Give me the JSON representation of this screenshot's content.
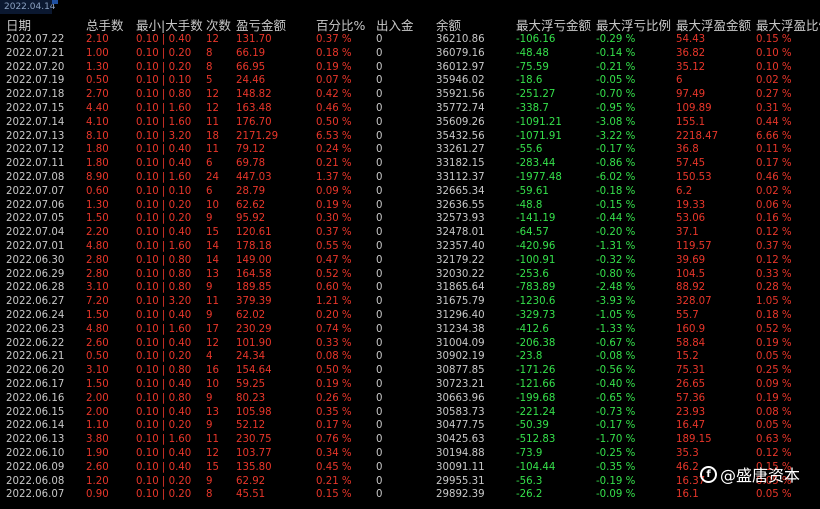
{
  "top_tab": "2022.04.14",
  "headers": [
    "日期",
    "总手数",
    "最小|大手数",
    "次数",
    "盈亏金额",
    "百分比%",
    "出入金",
    "余额",
    "最大浮亏金额",
    "最大浮亏比例",
    "最大浮盈金额",
    "最大浮盈比例"
  ],
  "rows": [
    [
      "2022.07.22",
      "2.10",
      "0.10 | 0.40",
      "12",
      "131.70",
      "0.37 %",
      "0",
      "36210.86",
      "-106.16",
      "-0.29 %",
      "54.43",
      "0.15 %"
    ],
    [
      "2022.07.21",
      "1.00",
      "0.10 | 0.20",
      "8",
      "66.19",
      "0.18 %",
      "0",
      "36079.16",
      "-48.48",
      "-0.14 %",
      "36.82",
      "0.10 %"
    ],
    [
      "2022.07.20",
      "1.30",
      "0.10 | 0.20",
      "8",
      "66.95",
      "0.19 %",
      "0",
      "36012.97",
      "-75.59",
      "-0.21 %",
      "35.12",
      "0.10 %"
    ],
    [
      "2022.07.19",
      "0.50",
      "0.10 | 0.10",
      "5",
      "24.46",
      "0.07 %",
      "0",
      "35946.02",
      "-18.6",
      "-0.05 %",
      "6",
      "0.02 %"
    ],
    [
      "2022.07.18",
      "2.70",
      "0.10 | 0.80",
      "12",
      "148.82",
      "0.42 %",
      "0",
      "35921.56",
      "-251.27",
      "-0.70 %",
      "97.49",
      "0.27 %"
    ],
    [
      "2022.07.15",
      "4.40",
      "0.10 | 1.60",
      "12",
      "163.48",
      "0.46 %",
      "0",
      "35772.74",
      "-338.7",
      "-0.95 %",
      "109.89",
      "0.31 %"
    ],
    [
      "2022.07.14",
      "4.10",
      "0.10 | 1.60",
      "11",
      "176.70",
      "0.50 %",
      "0",
      "35609.26",
      "-1091.21",
      "-3.08 %",
      "155.1",
      "0.44 %"
    ],
    [
      "2022.07.13",
      "8.10",
      "0.10 | 3.20",
      "18",
      "2171.29",
      "6.53 %",
      "0",
      "35432.56",
      "-1071.91",
      "-3.22 %",
      "2218.47",
      "6.66 %"
    ],
    [
      "2022.07.12",
      "1.80",
      "0.10 | 0.40",
      "11",
      "79.12",
      "0.24 %",
      "0",
      "33261.27",
      "-55.6",
      "-0.17 %",
      "36.8",
      "0.11 %"
    ],
    [
      "2022.07.11",
      "1.80",
      "0.10 | 0.40",
      "6",
      "69.78",
      "0.21 %",
      "0",
      "33182.15",
      "-283.44",
      "-0.86 %",
      "57.45",
      "0.17 %"
    ],
    [
      "2022.07.08",
      "8.90",
      "0.10 | 1.60",
      "24",
      "447.03",
      "1.37 %",
      "0",
      "33112.37",
      "-1977.48",
      "-6.02 %",
      "150.53",
      "0.46 %"
    ],
    [
      "2022.07.07",
      "0.60",
      "0.10 | 0.10",
      "6",
      "28.79",
      "0.09 %",
      "0",
      "32665.34",
      "-59.61",
      "-0.18 %",
      "6.2",
      "0.02 %"
    ],
    [
      "2022.07.06",
      "1.30",
      "0.10 | 0.20",
      "10",
      "62.62",
      "0.19 %",
      "0",
      "32636.55",
      "-48.8",
      "-0.15 %",
      "19.33",
      "0.06 %"
    ],
    [
      "2022.07.05",
      "1.50",
      "0.10 | 0.20",
      "9",
      "95.92",
      "0.30 %",
      "0",
      "32573.93",
      "-141.19",
      "-0.44 %",
      "53.06",
      "0.16 %"
    ],
    [
      "2022.07.04",
      "2.20",
      "0.10 | 0.40",
      "15",
      "120.61",
      "0.37 %",
      "0",
      "32478.01",
      "-64.57",
      "-0.20 %",
      "37.1",
      "0.12 %"
    ],
    [
      "2022.07.01",
      "4.80",
      "0.10 | 1.60",
      "14",
      "178.18",
      "0.55 %",
      "0",
      "32357.40",
      "-420.96",
      "-1.31 %",
      "119.57",
      "0.37 %"
    ],
    [
      "2022.06.30",
      "2.80",
      "0.10 | 0.80",
      "14",
      "149.00",
      "0.47 %",
      "0",
      "32179.22",
      "-100.91",
      "-0.32 %",
      "39.69",
      "0.12 %"
    ],
    [
      "2022.06.29",
      "2.80",
      "0.10 | 0.80",
      "13",
      "164.58",
      "0.52 %",
      "0",
      "32030.22",
      "-253.6",
      "-0.80 %",
      "104.5",
      "0.33 %"
    ],
    [
      "2022.06.28",
      "3.10",
      "0.10 | 0.80",
      "9",
      "189.85",
      "0.60 %",
      "0",
      "31865.64",
      "-783.89",
      "-2.48 %",
      "88.92",
      "0.28 %"
    ],
    [
      "2022.06.27",
      "7.20",
      "0.10 | 3.20",
      "11",
      "379.39",
      "1.21 %",
      "0",
      "31675.79",
      "-1230.6",
      "-3.93 %",
      "328.07",
      "1.05 %"
    ],
    [
      "2022.06.24",
      "1.50",
      "0.10 | 0.40",
      "9",
      "62.02",
      "0.20 %",
      "0",
      "31296.40",
      "-329.73",
      "-1.05 %",
      "55.7",
      "0.18 %"
    ],
    [
      "2022.06.23",
      "4.80",
      "0.10 | 1.60",
      "17",
      "230.29",
      "0.74 %",
      "0",
      "31234.38",
      "-412.6",
      "-1.33 %",
      "160.9",
      "0.52 %"
    ],
    [
      "2022.06.22",
      "2.60",
      "0.10 | 0.40",
      "12",
      "101.90",
      "0.33 %",
      "0",
      "31004.09",
      "-206.38",
      "-0.67 %",
      "58.84",
      "0.19 %"
    ],
    [
      "2022.06.21",
      "0.50",
      "0.10 | 0.20",
      "4",
      "24.34",
      "0.08 %",
      "0",
      "30902.19",
      "-23.8",
      "-0.08 %",
      "15.2",
      "0.05 %"
    ],
    [
      "2022.06.20",
      "3.10",
      "0.10 | 0.80",
      "16",
      "154.64",
      "0.50 %",
      "0",
      "30877.85",
      "-171.26",
      "-0.56 %",
      "75.31",
      "0.25 %"
    ],
    [
      "2022.06.17",
      "1.50",
      "0.10 | 0.40",
      "10",
      "59.25",
      "0.19 %",
      "0",
      "30723.21",
      "-121.66",
      "-0.40 %",
      "26.65",
      "0.09 %"
    ],
    [
      "2022.06.16",
      "2.00",
      "0.10 | 0.80",
      "9",
      "80.23",
      "0.26 %",
      "0",
      "30663.96",
      "-199.68",
      "-0.65 %",
      "57.36",
      "0.19 %"
    ],
    [
      "2022.06.15",
      "2.00",
      "0.10 | 0.40",
      "13",
      "105.98",
      "0.35 %",
      "0",
      "30583.73",
      "-221.24",
      "-0.73 %",
      "23.93",
      "0.08 %"
    ],
    [
      "2022.06.14",
      "1.10",
      "0.10 | 0.20",
      "9",
      "52.12",
      "0.17 %",
      "0",
      "30477.75",
      "-50.39",
      "-0.17 %",
      "16.47",
      "0.05 %"
    ],
    [
      "2022.06.13",
      "3.80",
      "0.10 | 1.60",
      "11",
      "230.75",
      "0.76 %",
      "0",
      "30425.63",
      "-512.83",
      "-1.70 %",
      "189.15",
      "0.63 %"
    ],
    [
      "2022.06.10",
      "1.90",
      "0.10 | 0.40",
      "12",
      "103.77",
      "0.34 %",
      "0",
      "30194.88",
      "-73.9",
      "-0.25 %",
      "35.3",
      "0.12 %"
    ],
    [
      "2022.06.09",
      "2.60",
      "0.10 | 0.40",
      "15",
      "135.80",
      "0.45 %",
      "0",
      "30091.11",
      "-104.44",
      "-0.35 %",
      "46.2",
      "0.15 %"
    ],
    [
      "2022.06.08",
      "1.20",
      "0.10 | 0.20",
      "9",
      "62.92",
      "0.21 %",
      "0",
      "29955.31",
      "-56.3",
      "-0.19 %",
      "16.37",
      "0.05 %"
    ],
    [
      "2022.06.07",
      "0.90",
      "0.10 | 0.20",
      "8",
      "45.51",
      "0.15 %",
      "0",
      "29892.39",
      "-26.2",
      "-0.09 %",
      "16.1",
      "0.05 %"
    ]
  ],
  "watermark": {
    "icon": "logo-icon",
    "icon_glyph": "f",
    "text": "@盛唐资本"
  }
}
